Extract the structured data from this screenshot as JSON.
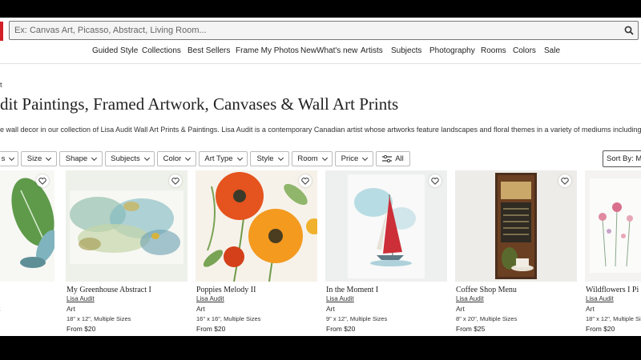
{
  "search": {
    "placeholder": "Ex: Canvas Art, Picasso, Abstract, Living Room..."
  },
  "nav": [
    "Guided Style",
    "Collections",
    "Best Sellers",
    "Frame My Photos",
    "NewWhat's new",
    "Artists",
    "Subjects",
    "Photography",
    "Rooms",
    "Colors",
    "Sale"
  ],
  "breadcrumb": "t",
  "page_title": "dit Paintings, Framed Artwork, Canvases & Wall Art Prints",
  "description": "e wall decor in our collection of Lisa Audit Wall Art Prints & Paintings. Lisa Audit is a contemporary Canadian artist whose artworks feature landscapes and floral themes in a variety of mediums including oil pa",
  "filters": [
    "s",
    "Size",
    "Shape",
    "Subjects",
    "Color",
    "Art Type",
    "Style",
    "Room",
    "Price"
  ],
  "all_filters_label": "All",
  "sort_label": "Sort By: Mo",
  "products": [
    {
      "name": "",
      "artist": "",
      "type": "t",
      "size": "",
      "price": ""
    },
    {
      "name": "My Greenhouse Abstract I",
      "artist": "Lisa Audit",
      "type": "Art",
      "size": "18\" x 12\", Multiple Sizes",
      "price": "From $20"
    },
    {
      "name": "Poppies Melody II",
      "artist": "Lisa Audit",
      "type": "Art",
      "size": "16\" x 16\", Multiple Sizes",
      "price": "From $20"
    },
    {
      "name": "In the Moment I",
      "artist": "Lisa Audit",
      "type": "Art",
      "size": "9\" x 12\", Multiple Sizes",
      "price": "From $20"
    },
    {
      "name": "Coffee Shop Menu",
      "artist": "Lisa Audit",
      "type": "Art",
      "size": "8\" x 20\", Multiple Sizes",
      "price": "From $25"
    },
    {
      "name": "Wildflowers I Pi",
      "artist": "Lisa Audit",
      "type": "Art",
      "size": "18\" x 12\", Multiple Sizes",
      "price": "From $20"
    }
  ],
  "colors": {
    "brand": "#d32027",
    "text": "#222222"
  },
  "icons": {
    "search": "search-icon",
    "favorite": "heart-icon",
    "filters": "sliders-icon",
    "dropdown": "chevron-down-icon"
  }
}
